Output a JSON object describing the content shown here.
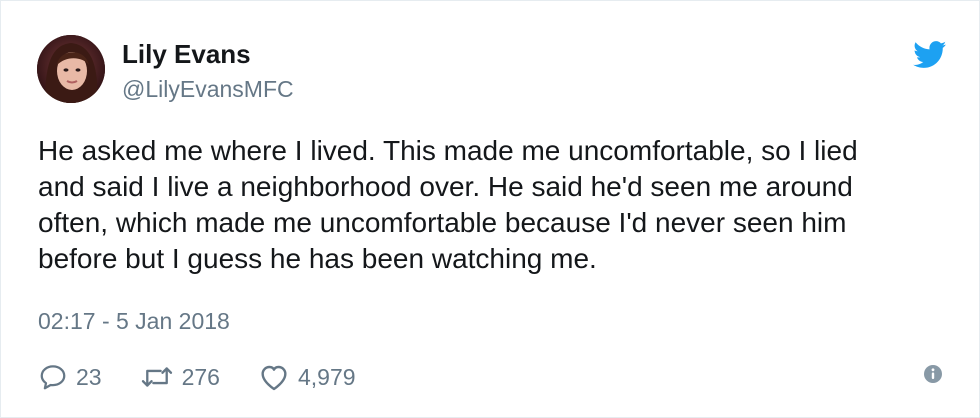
{
  "user": {
    "display_name": "Lily Evans",
    "handle": "@LilyEvansMFC",
    "avatar": "profile-photo"
  },
  "tweet": {
    "lines": [
      "He asked me where I lived. This made me uncomfortable, so I lied",
      "and said I live a neighborhood over. He said he'd seen me around",
      "often, which made me uncomfortable because I'd never seen him",
      "before but I guess he has been watching me."
    ],
    "timestamp": "02:17 - 5 Jan 2018"
  },
  "actions": {
    "replies": "23",
    "retweets": "276",
    "likes": "4,979"
  },
  "icons": {
    "brand": "twitter-bird-icon",
    "reply": "reply-icon",
    "retweet": "retweet-icon",
    "like": "heart-icon",
    "info": "info-icon"
  },
  "colors": {
    "brand": "#1da1f2",
    "text": "#14171a",
    "muted": "#657786"
  }
}
